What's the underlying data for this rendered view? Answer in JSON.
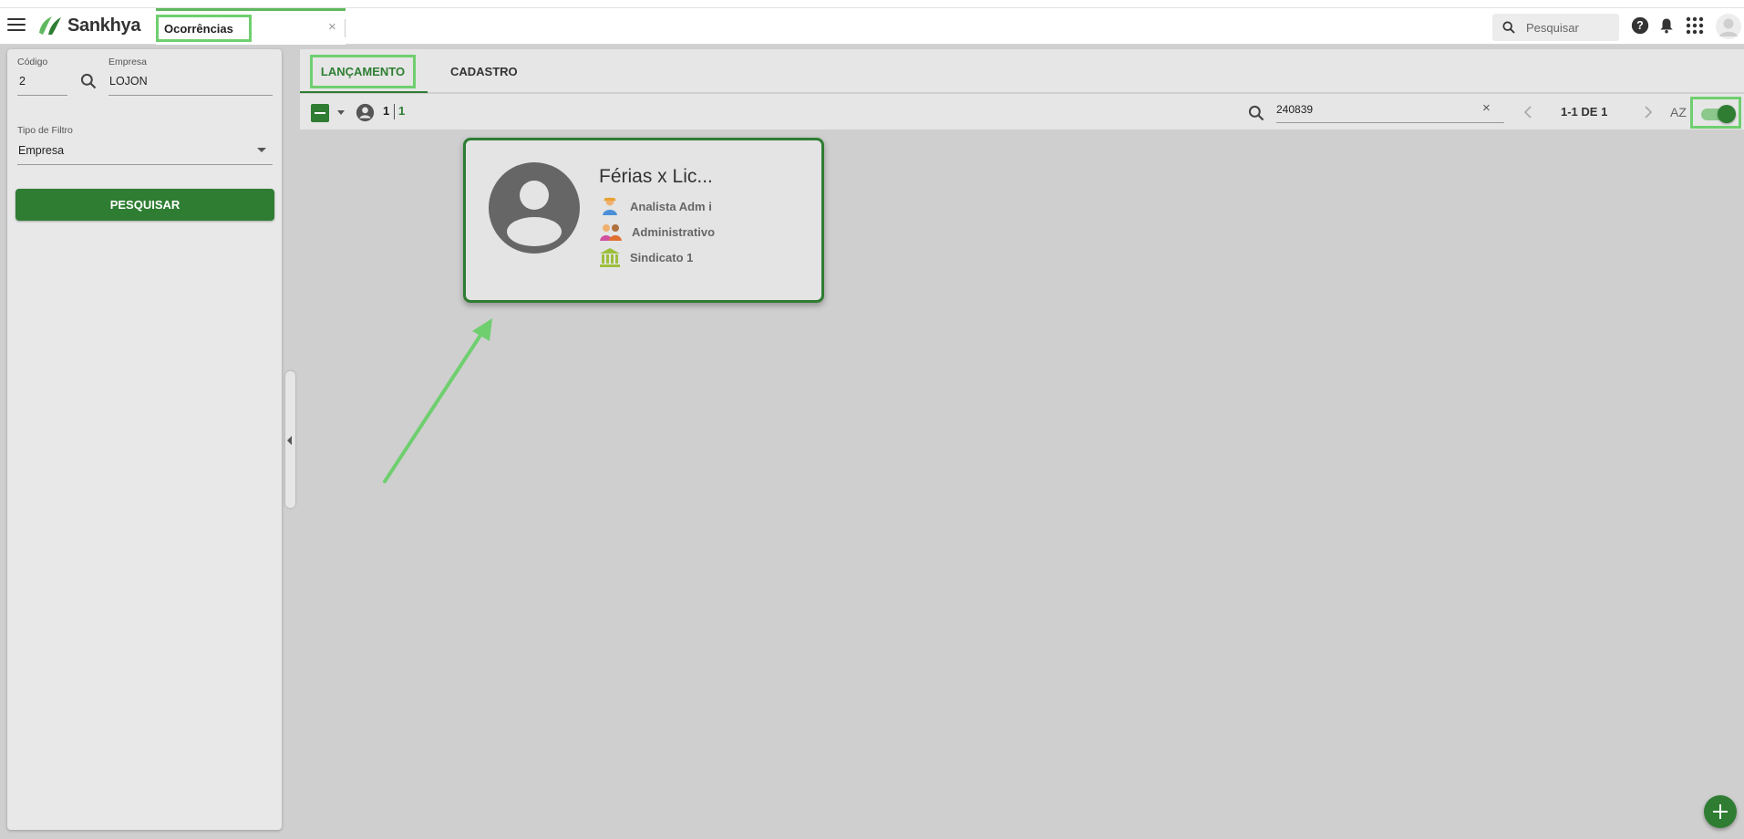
{
  "header": {
    "brand": "Sankhya",
    "tab_label": "Ocorrências",
    "tab_close": "×",
    "search_placeholder": "Pesquisar"
  },
  "filters": {
    "codigo_label": "Código",
    "codigo_value": "2",
    "empresa_label": "Empresa",
    "empresa_value": "LOJON",
    "tipo_label": "Tipo de Filtro",
    "tipo_value": "Empresa",
    "search_button": "PESQUISAR"
  },
  "tabs": [
    {
      "label": "LANÇAMENTO",
      "active": true
    },
    {
      "label": "CADASTRO",
      "active": false
    }
  ],
  "toolbar": {
    "count_selected": "1",
    "count_total": "1",
    "search_value": "240839",
    "clear": "×",
    "pager": "1-1 DE 1",
    "sort_label": "AZ",
    "toggle_on": true
  },
  "card": {
    "title": "Férias x Lic...",
    "role": "Analista Adm i",
    "department": "Administrativo",
    "union": "Sindicato 1"
  },
  "colors": {
    "accent": "#2e7d32",
    "highlight": "#6fcf6f",
    "background": "#cfcfcf"
  }
}
